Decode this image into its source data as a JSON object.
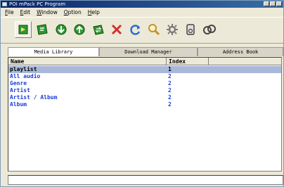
{
  "window": {
    "title": "POI mPack PC Program"
  },
  "menu": [
    "File",
    "Edit",
    "Window",
    "Option",
    "Help"
  ],
  "toolbar": {
    "buttons": [
      {
        "icon": "media-library-icon",
        "color": "#2e9a2e"
      },
      {
        "icon": "playlist-icon",
        "color": "#2e9a2e"
      },
      {
        "icon": "download-icon",
        "color": "#2e9a2e"
      },
      {
        "icon": "upload-icon",
        "color": "#2e9a2e"
      },
      {
        "icon": "sync-icon",
        "color": "#2e9a2e"
      },
      {
        "icon": "delete-icon",
        "color": "#d03030"
      },
      {
        "icon": "refresh-icon",
        "color": "#2f6ad0"
      },
      {
        "icon": "search-icon",
        "color": "#c4902a"
      },
      {
        "icon": "settings-icon",
        "color": "#7a7a7a"
      },
      {
        "icon": "device-icon",
        "color": "#444444"
      },
      {
        "icon": "exit-icon",
        "color": "#444444"
      }
    ]
  },
  "tabs": [
    {
      "label": "Media Library",
      "active": true
    },
    {
      "label": "Download Manager",
      "active": false
    },
    {
      "label": "Address Book",
      "active": false
    }
  ],
  "list": {
    "columns": [
      "Name",
      "Index"
    ],
    "rows": [
      {
        "name": "playlist",
        "index": "1",
        "selected": true
      },
      {
        "name": "All audio",
        "index": "2",
        "selected": false
      },
      {
        "name": "Genre",
        "index": "2",
        "selected": false
      },
      {
        "name": "Artist",
        "index": "2",
        "selected": false
      },
      {
        "name": "Artist / Album",
        "index": "2",
        "selected": false
      },
      {
        "name": "Album",
        "index": "2",
        "selected": false
      }
    ]
  },
  "colors": {
    "selection": "#a9b7d9",
    "row_text": "#1a3cd6",
    "titlebar": "#0a246a"
  }
}
